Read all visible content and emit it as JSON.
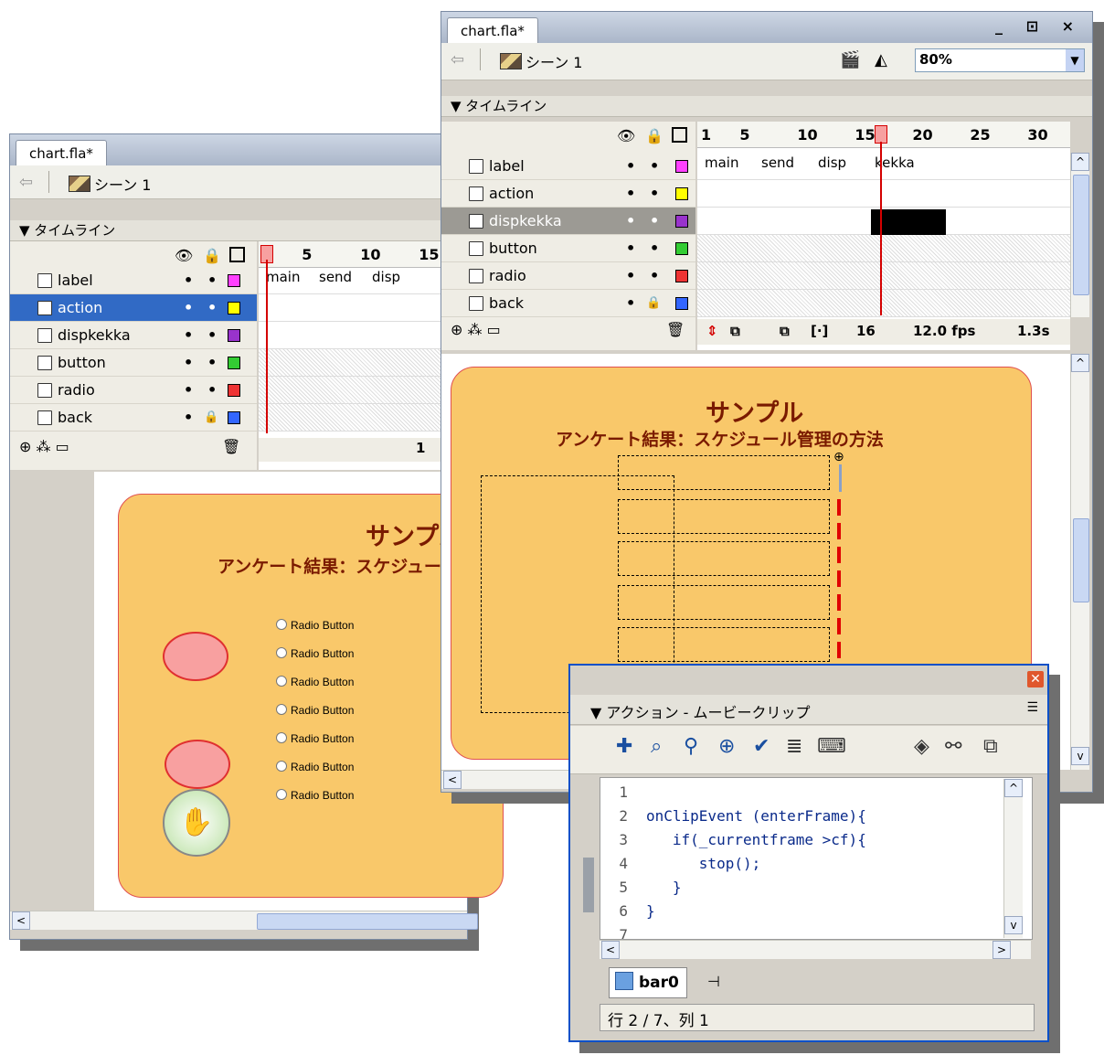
{
  "back_window": {
    "tab": "chart.fla*",
    "scene": "シーン 1",
    "timeline_header": "▼ タイムライン",
    "ruler_ticks": [
      "1",
      "5",
      "10",
      "15"
    ],
    "layers": [
      {
        "name": "label",
        "color": "#ff40ff"
      },
      {
        "name": "action",
        "color": "#ffff00"
      },
      {
        "name": "dispkekka",
        "color": "#9933cc"
      },
      {
        "name": "button",
        "color": "#33cc33"
      },
      {
        "name": "radio",
        "color": "#ee3333"
      },
      {
        "name": "back",
        "color": "#3366ff"
      }
    ],
    "frame_labels": [
      "main",
      "send",
      "disp"
    ],
    "current_frame": "1",
    "stage": {
      "title": "サンプル",
      "subtitle": "アンケート結果：スケジュー",
      "radio_buttons": [
        "Radio Button",
        "Radio Button",
        "Radio Button",
        "Radio Button",
        "Radio Button",
        "Radio Button",
        "Radio Button"
      ]
    }
  },
  "front_window": {
    "tab": "chart.fla*",
    "window_controls": "_ ⊡ ×",
    "scene": "シーン 1",
    "zoom": "80%",
    "timeline_header": "▼ タイムライン",
    "ruler_ticks": [
      "1",
      "5",
      "10",
      "15",
      "20",
      "25",
      "30"
    ],
    "layers": [
      {
        "name": "label",
        "color": "#ff40ff"
      },
      {
        "name": "action",
        "color": "#ffff00"
      },
      {
        "name": "dispkekka",
        "color": "#9933cc"
      },
      {
        "name": "button",
        "color": "#33cc33"
      },
      {
        "name": "radio",
        "color": "#ee3333"
      },
      {
        "name": "back",
        "color": "#3366ff"
      }
    ],
    "frame_labels": [
      "main",
      "send",
      "disp",
      "kekka"
    ],
    "current_frame": "16",
    "fps": "12.0 fps",
    "elapsed": "1.3s",
    "stage": {
      "title": "サンプル",
      "subtitle": "アンケート結果：スケジュール管理の方法"
    }
  },
  "actions_panel": {
    "header": "▼ アクション - ムービークリップ",
    "code_lines": [
      {
        "n": "1",
        "text": ""
      },
      {
        "n": "2",
        "text": "onClipEvent (enterFrame){"
      },
      {
        "n": "3",
        "text": "   if(_currentframe >cf){"
      },
      {
        "n": "4",
        "text": "      stop();"
      },
      {
        "n": "5",
        "text": "   }"
      },
      {
        "n": "6",
        "text": "}"
      },
      {
        "n": "7",
        "text": ""
      }
    ],
    "tab_label": "bar0",
    "status": "行 2 / 7、列 1"
  }
}
